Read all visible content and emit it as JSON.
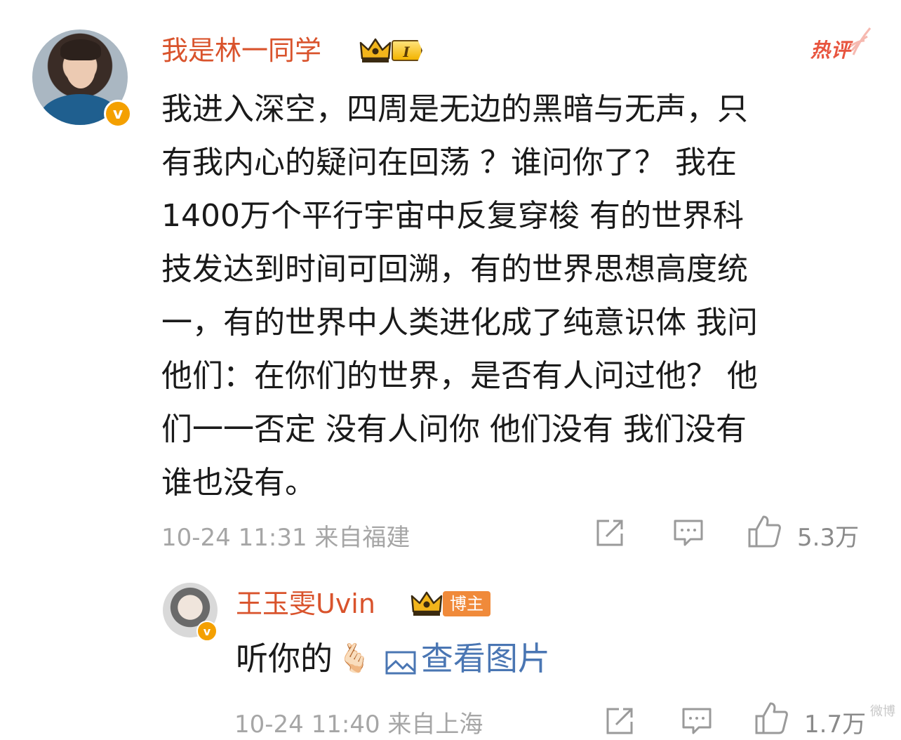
{
  "comment": {
    "username": "我是林一同学",
    "level_label": "I",
    "hot_label": "热评",
    "body": "我进入深空，四周是无边的黑暗与无声，只\n有我内心的疑问在回荡 ？谁问你了？ 我在\n1400万个平行宇宙中反复穿梭 有的世界科\n技发达到时间可回溯，有的世界思想高度统\n一，有的世界中人类进化成了纯意识体 我问\n他们：在你们的世界，是否有人问过他？ 他\n们一一否定 没有人问你 他们没有 我们没有\n谁也没有。",
    "meta": "10-24 11:31 来自福建",
    "like_count": "5.3万",
    "verified_mark": "v"
  },
  "reply": {
    "username": "王玉雯Uvin",
    "role_label": "博主",
    "text": "听你的",
    "emoji": "🫰🏻",
    "view_pic_label": "查看图片",
    "meta": "10-24 11:40 来自上海",
    "like_count": "1.7万",
    "verified_mark": "v"
  },
  "watermark": "微博",
  "colors": {
    "username": "#d9532c",
    "verified": "#f4a000",
    "link": "#4a76b3",
    "meta": "#a6a6a6",
    "hot": "#e8553f"
  },
  "icons": [
    "crown-icon",
    "share-icon",
    "comment-icon",
    "like-icon",
    "picture-icon",
    "hot-wing-icon"
  ]
}
